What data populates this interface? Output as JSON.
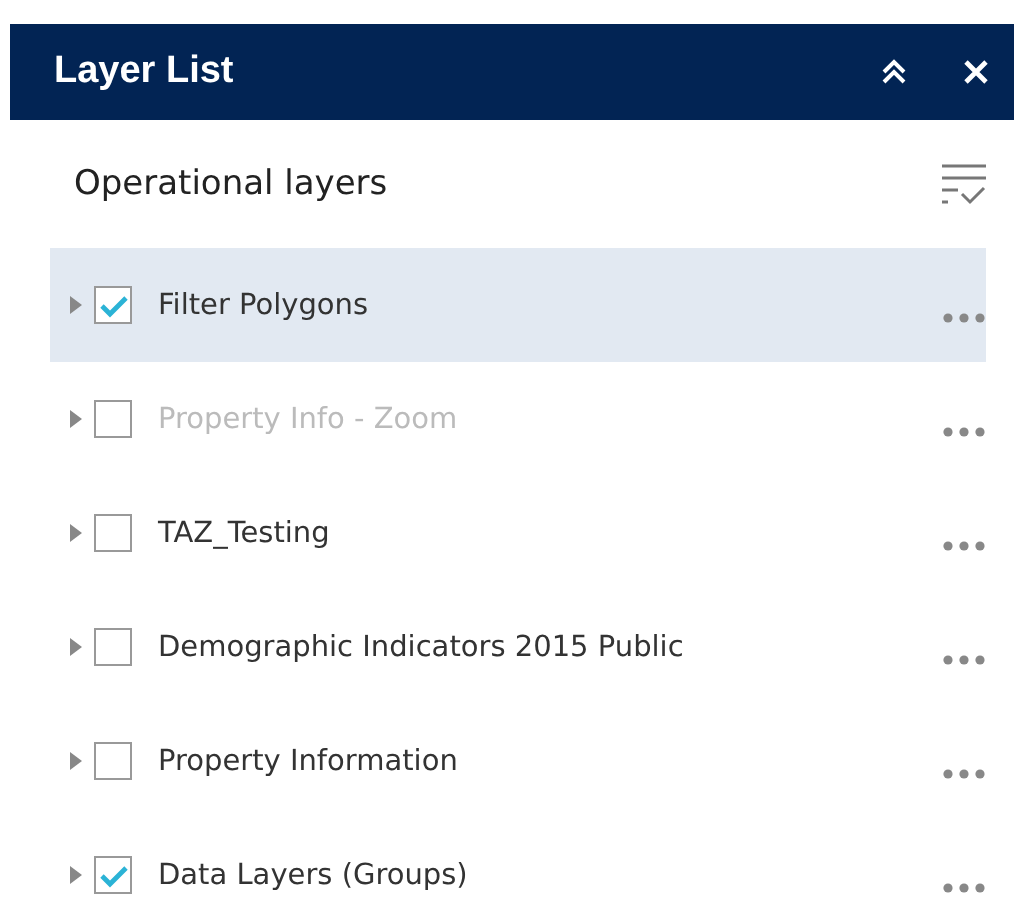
{
  "window": {
    "title": "Layer List"
  },
  "section": {
    "title": "Operational layers"
  },
  "layers": [
    {
      "name": "Filter Polygons",
      "checked": true,
      "selected": true,
      "dimmed": false
    },
    {
      "name": "Property Info - Zoom",
      "checked": false,
      "selected": false,
      "dimmed": true
    },
    {
      "name": "TAZ_Testing",
      "checked": false,
      "selected": false,
      "dimmed": false
    },
    {
      "name": "Demographic Indicators 2015 Public",
      "checked": false,
      "selected": false,
      "dimmed": false
    },
    {
      "name": "Property Information",
      "checked": false,
      "selected": false,
      "dimmed": false
    },
    {
      "name": "Data Layers (Groups)",
      "checked": true,
      "selected": false,
      "dimmed": false
    }
  ]
}
